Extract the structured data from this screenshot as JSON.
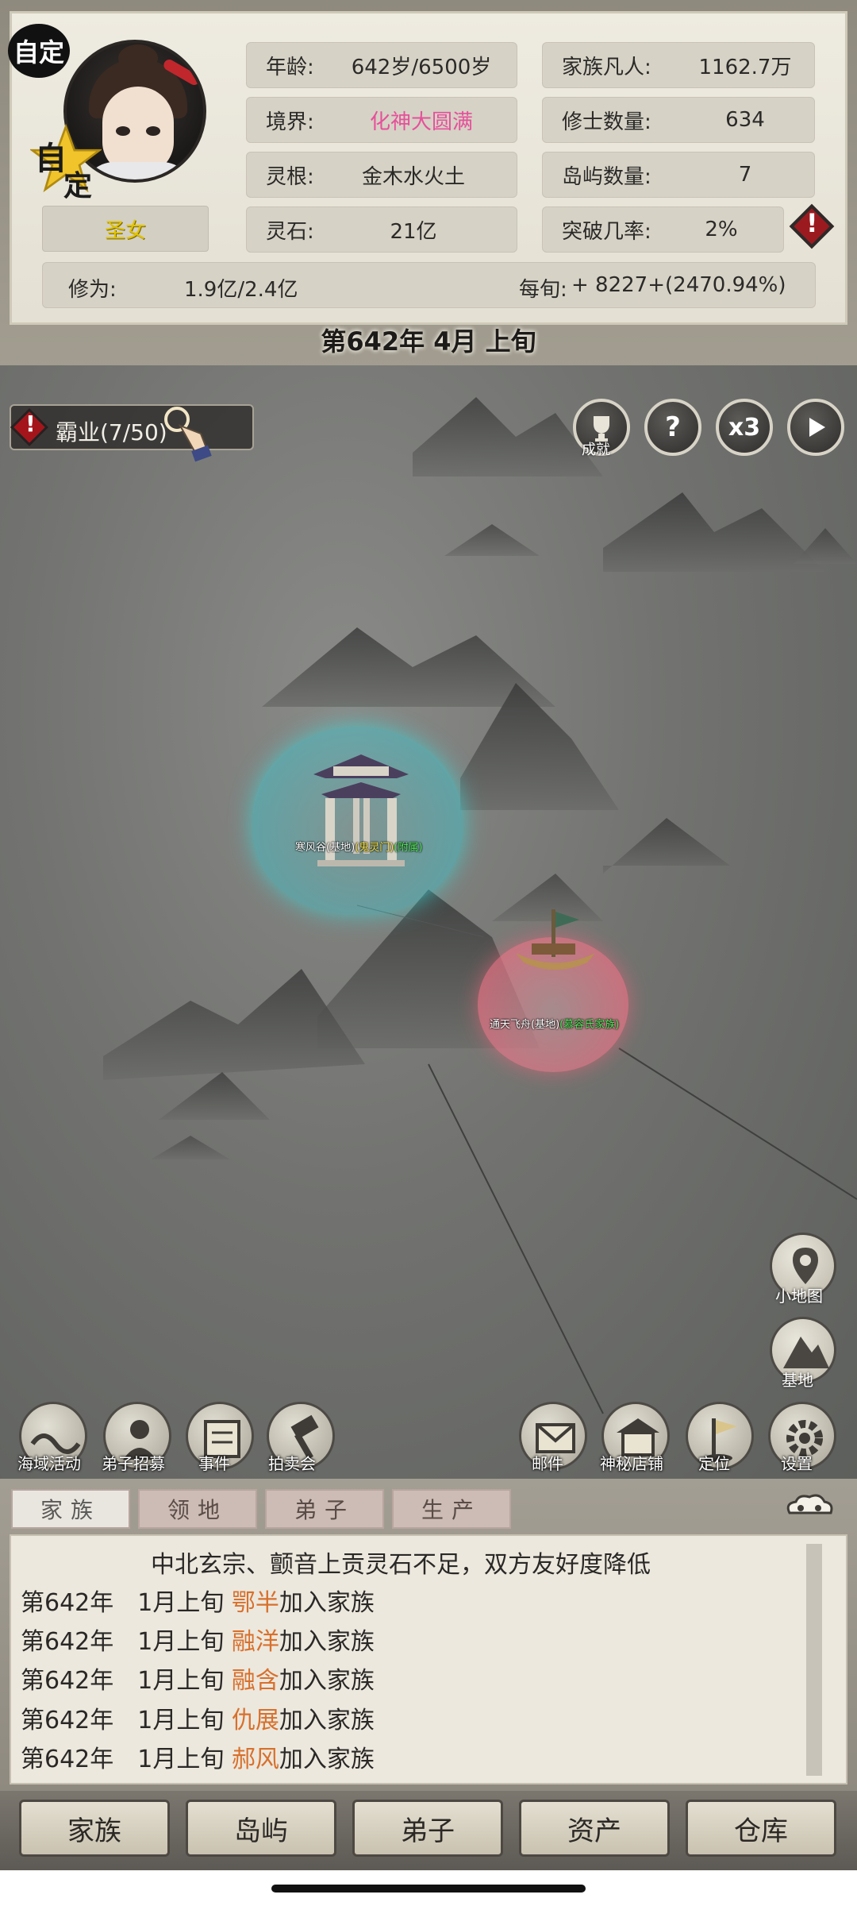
{
  "profile": {
    "auto_badge": "自定",
    "star_badge_top": "自",
    "star_badge_bottom": "定",
    "title": "圣女"
  },
  "stats": {
    "age_label": "年龄:",
    "age_value": "642岁/6500岁",
    "realm_label": "境界:",
    "realm_value": "化神大圆满",
    "root_label": "灵根:",
    "root_value": "金木水火土",
    "stone_label": "灵石:",
    "stone_value": "21亿",
    "mortals_label": "家族凡人:",
    "mortals_value": "1162.7万",
    "cultivators_label": "修士数量:",
    "cultivators_value": "634",
    "islands_label": "岛屿数量:",
    "islands_value": "7",
    "breakthrough_label": "突破几率:",
    "breakthrough_value": "2%",
    "cultivation_label": "修为:",
    "cultivation_value": "1.9亿/2.4亿",
    "per_period_label": "每旬:",
    "per_period_value": "+ 8227+(2470.94%)"
  },
  "date_banner": "第642年 4月 上旬",
  "quest": {
    "text": "霸业(7/50)"
  },
  "top_controls": {
    "achievement_caption": "成就",
    "help_symbol": "?",
    "speed_label": "x3"
  },
  "map_places": {
    "place1_name": "寒风谷(基地)",
    "place1_tag1": "(鬼灵门)",
    "place1_tag2": "(附属)",
    "place2_name": "通天飞舟(基地)",
    "place2_tag": "(慕容氏家族)"
  },
  "side_buttons": {
    "minimap": "小地图",
    "base": "基地"
  },
  "actions_left": [
    "海域活动",
    "弟子招募",
    "事件",
    "拍卖会"
  ],
  "actions_right": [
    "邮件",
    "神秘店铺",
    "定位",
    "设置"
  ],
  "log_tabs": [
    "家族",
    "领地",
    "弟子",
    "生产"
  ],
  "log": {
    "header": "中北玄宗、颤音上贡灵石不足，双方友好度降低",
    "entries": [
      {
        "year": "第642年",
        "period": "1月上旬",
        "name": "鄂半",
        "action": "加入家族"
      },
      {
        "year": "第642年",
        "period": "1月上旬",
        "name": "融洋",
        "action": "加入家族"
      },
      {
        "year": "第642年",
        "period": "1月上旬",
        "name": "融含",
        "action": "加入家族"
      },
      {
        "year": "第642年",
        "period": "1月上旬",
        "name": "仇展",
        "action": "加入家族"
      },
      {
        "year": "第642年",
        "period": "1月上旬",
        "name": "郝风",
        "action": "加入家族"
      }
    ]
  },
  "bottom_nav": [
    "家族",
    "岛屿",
    "弟子",
    "资产",
    "仓库"
  ]
}
